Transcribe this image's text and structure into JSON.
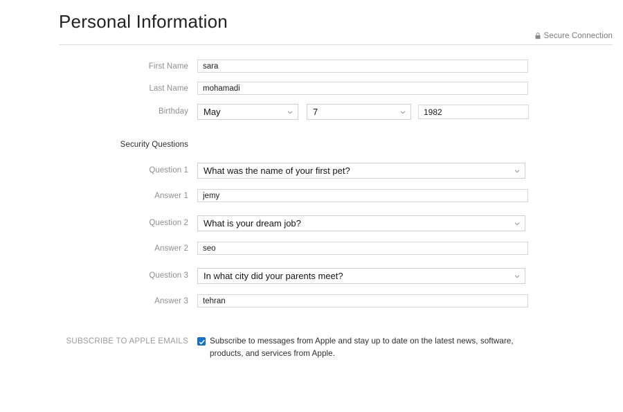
{
  "header": {
    "title": "Personal Information",
    "secure_label": "Secure Connection",
    "lock_icon": "lock-icon"
  },
  "form": {
    "first_name": {
      "label": "First Name",
      "value": "sara"
    },
    "last_name": {
      "label": "Last Name",
      "value": "mohamadi"
    },
    "birthday": {
      "label": "Birthday",
      "month": "May",
      "day": "7",
      "year": "1982"
    },
    "security_section_title": "Security Questions",
    "security": [
      {
        "question_label": "Question 1",
        "question_value": "What was the name of your first pet?",
        "answer_label": "Answer 1",
        "answer_value": "jemy"
      },
      {
        "question_label": "Question 2",
        "question_value": "What is your dream job?",
        "answer_label": "Answer 2",
        "answer_value": "seo"
      },
      {
        "question_label": "Question 3",
        "question_value": "In what city did your parents meet?",
        "answer_label": "Answer 3",
        "answer_value": "tehran"
      }
    ]
  },
  "subscribe": {
    "label": "SUBSCRIBE TO APPLE EMAILS",
    "text": "Subscribe to messages from Apple and stay up to date on the latest news, software, products, and services from Apple.",
    "checked": true
  },
  "colors": {
    "checkbox_blue": "#1473cc",
    "label_gray": "#8e8e8e",
    "value_dark": "#1a1a1a",
    "divider": "#dcdcdc"
  }
}
